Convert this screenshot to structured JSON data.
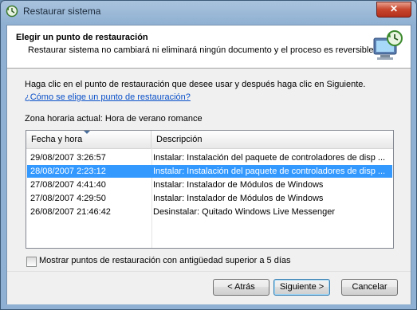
{
  "window": {
    "title": "Restaurar sistema",
    "close_label": "✕"
  },
  "header": {
    "title": "Elegir un punto de restauración",
    "subtitle": "Restaurar sistema no cambiará ni eliminará ningún documento y el proceso es reversible."
  },
  "instruction": "Haga clic en el punto de restauración que desee usar y después haga clic en Siguiente.",
  "help_link": "¿Cómo se elige un punto de restauración?",
  "timezone": "Zona horaria actual: Hora de verano romance",
  "list": {
    "columns": [
      "Fecha y hora",
      "Descripción"
    ],
    "rows": [
      {
        "date": "29/08/2007 3:26:57",
        "desc": "Instalar: Instalación del paquete de controladores de disp ...",
        "selected": false
      },
      {
        "date": "28/08/2007 2:23:12",
        "desc": "Instalar: Instalación del paquete de controladores de disp ...",
        "selected": true
      },
      {
        "date": "27/08/2007 4:41:40",
        "desc": "Instalar: Instalador de Módulos de Windows",
        "selected": false
      },
      {
        "date": "27/08/2007 4:29:50",
        "desc": "Instalar: Instalador de Módulos de Windows",
        "selected": false
      },
      {
        "date": "26/08/2007 21:46:42",
        "desc": "Desinstalar: Quitado Windows Live Messenger",
        "selected": false
      }
    ]
  },
  "show_more_label": "Mostrar puntos de restauración con antigüedad superior a 5 días",
  "buttons": {
    "back": "< Atrás",
    "next": "Siguiente >",
    "cancel": "Cancelar"
  },
  "colors": {
    "selection": "#3399ff",
    "link": "#0a50c8",
    "close": "#c7452c"
  }
}
